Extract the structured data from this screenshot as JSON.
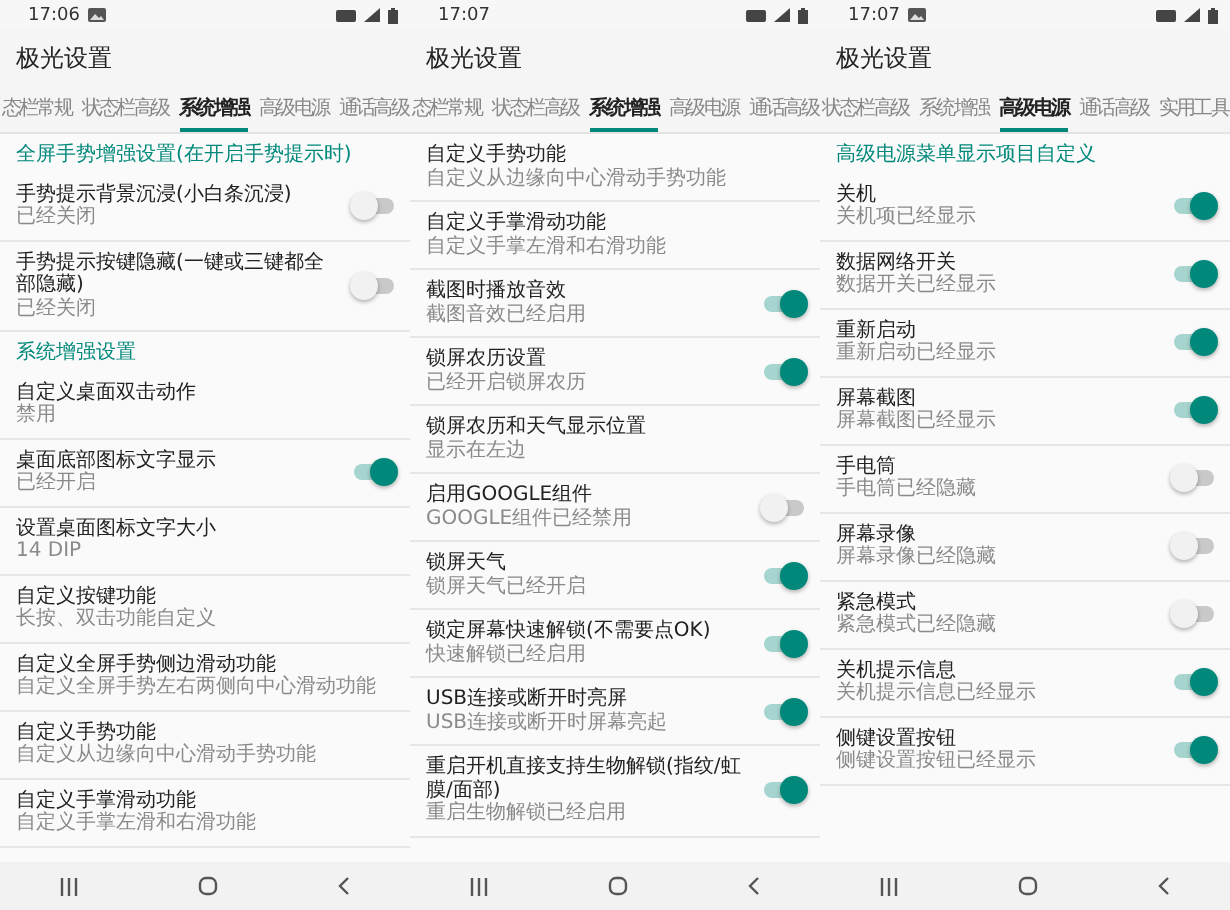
{
  "panels": [
    {
      "status_bar": {
        "time": "17:06",
        "notification_icon": true
      },
      "title": "极光设置",
      "tabs": [
        {
          "label": "态栏常规",
          "selected": false
        },
        {
          "label": "状态栏高级",
          "selected": false
        },
        {
          "label": "系统增强",
          "selected": true
        },
        {
          "label": "高级电源",
          "selected": false
        },
        {
          "label": "通话高级",
          "selected": false
        }
      ],
      "items": [
        {
          "kind": "header",
          "label": "全屏手势增强设置(在开启手势提示时)"
        },
        {
          "kind": "toggle",
          "title": "手势提示背景沉浸(小白条沉浸)",
          "subtitle": "已经关闭",
          "on": false
        },
        {
          "kind": "toggle",
          "title": "手势提示按键隐藏(一键或三键都全部隐藏)",
          "subtitle": "已经关闭",
          "on": false
        },
        {
          "kind": "header",
          "label": "系统增强设置"
        },
        {
          "kind": "setting",
          "title": "自定义桌面双击动作",
          "subtitle": "禁用"
        },
        {
          "kind": "toggle",
          "title": "桌面底部图标文字显示",
          "subtitle": "已经开启",
          "on": true
        },
        {
          "kind": "setting",
          "title": "设置桌面图标文字大小",
          "subtitle": "14 DIP"
        },
        {
          "kind": "setting",
          "title": "自定义按键功能",
          "subtitle": "长按、双击功能自定义"
        },
        {
          "kind": "setting",
          "title": "自定义全屏手势侧边滑动功能",
          "subtitle": "自定义全屏手势左右两侧向中心滑动功能"
        },
        {
          "kind": "setting",
          "title": "自定义手势功能",
          "subtitle": "自定义从边缘向中心滑动手势功能"
        },
        {
          "kind": "setting",
          "title": "自定义手掌滑动功能",
          "subtitle": "自定义手掌左滑和右滑功能"
        }
      ]
    },
    {
      "status_bar": {
        "time": "17:07",
        "notification_icon": false
      },
      "title": "极光设置",
      "tabs": [
        {
          "label": "态栏常规",
          "selected": false
        },
        {
          "label": "状态栏高级",
          "selected": false
        },
        {
          "label": "系统增强",
          "selected": true
        },
        {
          "label": "高级电源",
          "selected": false
        },
        {
          "label": "通话高级",
          "selected": false
        }
      ],
      "items": [
        {
          "kind": "setting",
          "title": "自定义手势功能",
          "subtitle": "自定义从边缘向中心滑动手势功能"
        },
        {
          "kind": "setting",
          "title": "自定义手掌滑动功能",
          "subtitle": "自定义手掌左滑和右滑功能"
        },
        {
          "kind": "toggle",
          "title": "截图时播放音效",
          "subtitle": "截图音效已经启用",
          "on": true
        },
        {
          "kind": "toggle",
          "title": "锁屏农历设置",
          "subtitle": "已经开启锁屏农历",
          "on": true
        },
        {
          "kind": "setting",
          "title": "锁屏农历和天气显示位置",
          "subtitle": "显示在左边"
        },
        {
          "kind": "toggle",
          "title": "启用GOOGLE组件",
          "subtitle": "GOOGLE组件已经禁用",
          "on": false
        },
        {
          "kind": "toggle",
          "title": "锁屏天气",
          "subtitle": "锁屏天气已经开启",
          "on": true
        },
        {
          "kind": "toggle",
          "title": "锁定屏幕快速解锁(不需要点OK)",
          "subtitle": "快速解锁已经启用",
          "on": true
        },
        {
          "kind": "toggle",
          "title": "USB连接或断开时亮屏",
          "subtitle": "USB连接或断开时屏幕亮起",
          "on": true
        },
        {
          "kind": "toggle",
          "title": "重启开机直接支持生物解锁(指纹/虹膜/面部)",
          "subtitle": "重启生物解锁已经启用",
          "on": true
        }
      ]
    },
    {
      "status_bar": {
        "time": "17:07",
        "notification_icon": true
      },
      "title": "极光设置",
      "tabs": [
        {
          "label": "状态栏高级",
          "selected": false
        },
        {
          "label": "系统增强",
          "selected": false
        },
        {
          "label": "高级电源",
          "selected": true
        },
        {
          "label": "通话高级",
          "selected": false
        },
        {
          "label": "实用工具",
          "selected": false
        }
      ],
      "items": [
        {
          "kind": "header",
          "label": "高级电源菜单显示项目自定义"
        },
        {
          "kind": "toggle",
          "title": "关机",
          "subtitle": "关机项已经显示",
          "on": true
        },
        {
          "kind": "toggle",
          "title": "数据网络开关",
          "subtitle": "数据开关已经显示",
          "on": true
        },
        {
          "kind": "toggle",
          "title": "重新启动",
          "subtitle": "重新启动已经显示",
          "on": true
        },
        {
          "kind": "toggle",
          "title": "屏幕截图",
          "subtitle": "屏幕截图已经显示",
          "on": true
        },
        {
          "kind": "toggle",
          "title": "手电筒",
          "subtitle": "手电筒已经隐藏",
          "on": false
        },
        {
          "kind": "toggle",
          "title": "屏幕录像",
          "subtitle": "屏幕录像已经隐藏",
          "on": false
        },
        {
          "kind": "toggle",
          "title": "紧急模式",
          "subtitle": "紧急模式已经隐藏",
          "on": false
        },
        {
          "kind": "toggle",
          "title": "关机提示信息",
          "subtitle": "关机提示信息已经显示",
          "on": true
        },
        {
          "kind": "toggle",
          "title": "侧键设置按钮",
          "subtitle": "侧键设置按钮已经显示",
          "on": true
        }
      ]
    }
  ]
}
